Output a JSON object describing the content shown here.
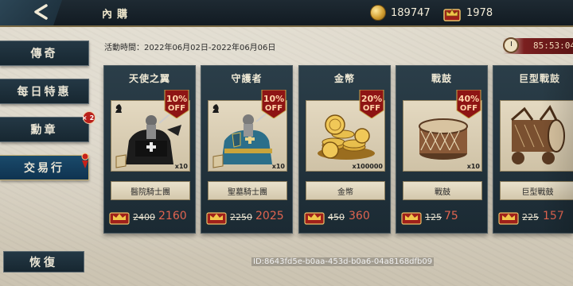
{
  "header": {
    "title": "內購",
    "gold_amount": "189747",
    "crown_amount": "1978"
  },
  "menu": [
    {
      "label": "傳奇",
      "badge": ""
    },
    {
      "label": "每日特惠",
      "badge": ""
    },
    {
      "label": "勳章",
      "badge": "×2"
    },
    {
      "label": "交易行",
      "badge": ""
    }
  ],
  "event_time": "活動時間：2022年06月02日-2022年06月06日",
  "timer": "85:53:04",
  "items": [
    {
      "title": "天使之翼",
      "off_pct": "10%",
      "off_word": "OFF",
      "qty": "x10",
      "name": "醫院騎士團",
      "old_price": "2400",
      "new_price": "2160"
    },
    {
      "title": "守護者",
      "off_pct": "10%",
      "off_word": "OFF",
      "qty": "x10",
      "name": "聖墓騎士團",
      "old_price": "2250",
      "new_price": "2025"
    },
    {
      "title": "金幣",
      "off_pct": "20%",
      "off_word": "OFF",
      "qty": "x100000",
      "name": "金幣",
      "old_price": "450",
      "new_price": "360"
    },
    {
      "title": "戰鼓",
      "off_pct": "40%",
      "off_word": "OFF",
      "qty": "x10",
      "name": "戰鼓",
      "old_price": "125",
      "new_price": "75"
    },
    {
      "title": "巨型戰鼓",
      "off_pct": "",
      "off_word": "",
      "qty": "",
      "name": "巨型戰鼓",
      "old_price": "225",
      "new_price": "157"
    }
  ],
  "footer": {
    "restore_label": "恢復",
    "id_text": "ID:8643fd5e-b0aa-453d-b0a6-04a8168dfb09"
  },
  "colors": {
    "accent_red": "#e06450",
    "panel_dark": "#1b2a33",
    "active_blue": "#0f3350"
  }
}
